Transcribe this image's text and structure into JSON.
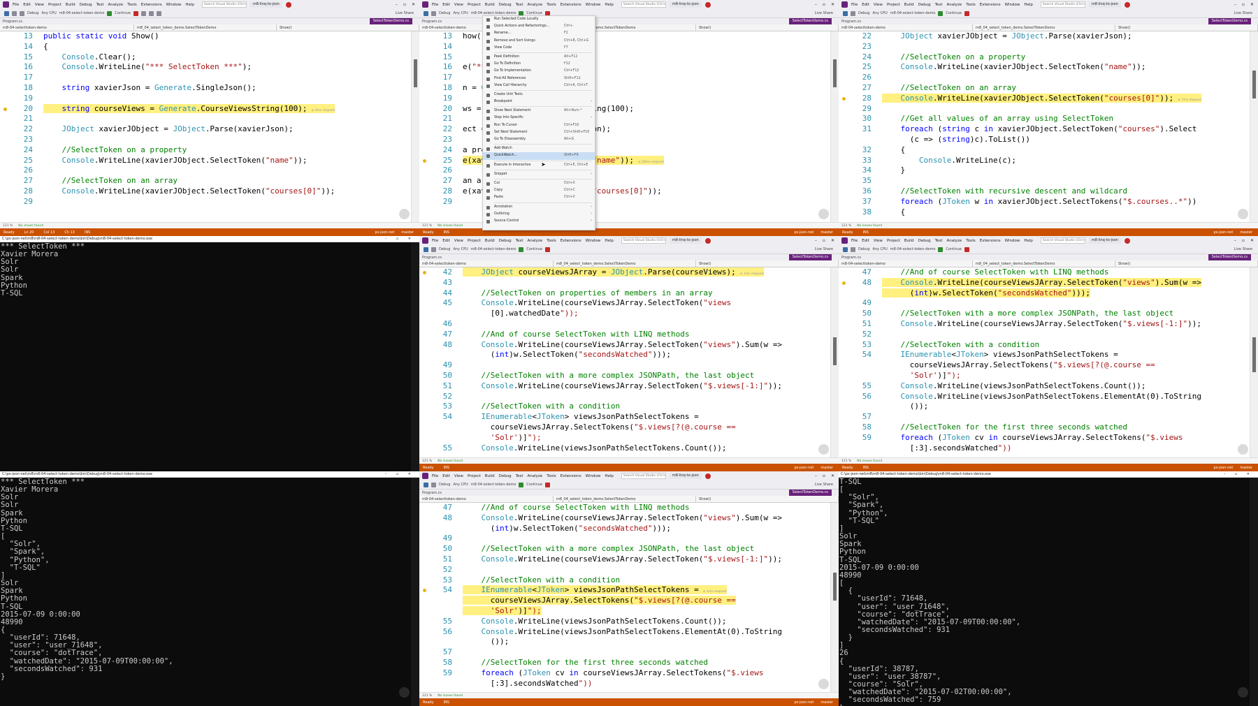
{
  "vs": {
    "menu": [
      "File",
      "Edit",
      "View",
      "Project",
      "Build",
      "Debug",
      "Test",
      "Analyze",
      "Tools",
      "Extensions",
      "Window",
      "Help"
    ],
    "search_placeholder": "Search Visual Studio (Ctrl+Q)",
    "solution": "m8-linq-to-json",
    "live_share": "Live Share",
    "continue": "Continue",
    "debug_config": "Debug",
    "cpu_config": "Any CPU",
    "project_path": "m8-04-select-token-demo",
    "tab_program": "Program.cs",
    "tab_file": "SelectTokenDemo.cs",
    "nav_project": "m8-04-selecttoken-demo",
    "nav_class": "m8_04_select_token_demo.SelectTokenDemo",
    "nav_method": "Show()",
    "references": "1 reference",
    "status_ready": "Ready",
    "status_noissues": "No issues found",
    "status_zoom": "121 %",
    "status_repo": "ps-json-net",
    "status_branch": "master",
    "status_ins": "INS",
    "status_ln1": "Ln 20",
    "status_col1": "Col 13",
    "status_ch1": "Ch 13",
    "elapsed": "≤ 4ms elapsed",
    "elapsed2": "≤ 28ms elapsed",
    "elapsed3": "≤ 7ms elapsed",
    "elapsed4": "≤ 1ms elapsed"
  },
  "panes": {
    "p1": {
      "lines": [
        {
          "n": "13",
          "h": "public static void Show()"
        },
        {
          "n": "14",
          "h": "{"
        },
        {
          "n": "15",
          "h": "    Console.Clear();"
        },
        {
          "n": "16",
          "h": "    Console.WriteLine(\"*** SelectToken ***\");"
        },
        {
          "n": "17",
          "h": ""
        },
        {
          "n": "18",
          "h": "    string xavierJson = Generate.SingleJson();"
        },
        {
          "n": "19",
          "h": ""
        },
        {
          "n": "20",
          "h": "    string courseViews = Generate.CourseViewsString(100);"
        },
        {
          "n": "21",
          "h": ""
        },
        {
          "n": "22",
          "h": "    JObject xavierJObject = JObject.Parse(xavierJson);"
        },
        {
          "n": "23",
          "h": ""
        },
        {
          "n": "24",
          "h": "    //SelectToken on a property"
        },
        {
          "n": "25",
          "h": "    Console.WriteLine(xavierJObject.SelectToken(\"name\"));"
        },
        {
          "n": "26",
          "h": ""
        },
        {
          "n": "27",
          "h": "    //SelectToken on an array"
        },
        {
          "n": "28",
          "h": "    Console.WriteLine(xavierJObject.SelectToken(\"courses[0]\"));"
        },
        {
          "n": "29",
          "h": ""
        }
      ]
    },
    "p2": {
      "lines": [
        {
          "n": "13",
          "h": "how()"
        },
        {
          "n": "14",
          "h": ""
        },
        {
          "n": "15",
          "h": ""
        },
        {
          "n": "16",
          "h": "e(\"*** SelectToken ***\");"
        },
        {
          "n": "17",
          "h": ""
        },
        {
          "n": "18",
          "h": "n = Generate.SingleJson();"
        },
        {
          "n": "19",
          "h": ""
        },
        {
          "n": "20",
          "h": "ws = Generate.CourseViewsString(100);"
        },
        {
          "n": "21",
          "h": ""
        },
        {
          "n": "22",
          "h": "ect = JObject.Parse(xavierJson);"
        },
        {
          "n": "23",
          "h": ""
        },
        {
          "n": "24",
          "h": "a property"
        },
        {
          "n": "25",
          "h": "e(xavierJObject.SelectToken(\"name\"));"
        },
        {
          "n": "26",
          "h": ""
        },
        {
          "n": "27",
          "h": "an array"
        },
        {
          "n": "28",
          "h": "e(xavierJObject.SelectToken(\"courses[0]\"));"
        },
        {
          "n": "29",
          "h": ""
        }
      ]
    },
    "p3": {
      "lines": [
        {
          "n": "22",
          "h": "    JObject xavierJObject = JObject.Parse(xavierJson);"
        },
        {
          "n": "23",
          "h": ""
        },
        {
          "n": "24",
          "h": "    //SelectToken on a property"
        },
        {
          "n": "25",
          "h": "    Console.WriteLine(xavierJObject.SelectToken(\"name\"));"
        },
        {
          "n": "26",
          "h": ""
        },
        {
          "n": "27",
          "h": "    //SelectToken on an array"
        },
        {
          "n": "28",
          "h": "    Console.WriteLine(xavierJObject.SelectToken(\"courses[0]\"));"
        },
        {
          "n": "29",
          "h": ""
        },
        {
          "n": "30",
          "h": "    //Get all values of an array using SelectToken"
        },
        {
          "n": "31",
          "h": "    foreach (string c in xavierJObject.SelectToken(\"courses\").Select"
        },
        {
          "n": "",
          "h": "      (c => (string)c).ToList())"
        },
        {
          "n": "32",
          "h": "    {"
        },
        {
          "n": "33",
          "h": "        Console.WriteLine(c);"
        },
        {
          "n": "34",
          "h": "    }"
        },
        {
          "n": "35",
          "h": ""
        },
        {
          "n": "36",
          "h": "    //SelectToken with recursive descent and wildcard"
        },
        {
          "n": "37",
          "h": "    foreach (JToken w in xavierJObject.SelectTokens(\"$.courses..*\"))"
        },
        {
          "n": "38",
          "h": "    {"
        }
      ]
    },
    "p5": {
      "lines": [
        {
          "n": "42",
          "h": "    JObject courseViewsJArray = JObject.Parse(courseViews);"
        },
        {
          "n": "43",
          "h": ""
        },
        {
          "n": "44",
          "h": "    //SelectToken on properties of members in an array"
        },
        {
          "n": "45",
          "h": "    Console.WriteLine(courseViewsJArray.SelectToken(\"views"
        },
        {
          "n": "",
          "h": "      [0].watchedDate\"));"
        },
        {
          "n": "46",
          "h": ""
        },
        {
          "n": "47",
          "h": "    //And of course SelectToken with LINQ methods"
        },
        {
          "n": "48",
          "h": "    Console.WriteLine(courseViewsJArray.SelectToken(\"views\").Sum(w =>"
        },
        {
          "n": "",
          "h": "      (int)w.SelectToken(\"secondsWatched\")));"
        },
        {
          "n": "49",
          "h": ""
        },
        {
          "n": "50",
          "h": "    //SelectToken with a more complex JSONPath, the last object"
        },
        {
          "n": "51",
          "h": "    Console.WriteLine(courseViewsJArray.SelectToken(\"$.views[-1:]\"));"
        },
        {
          "n": "52",
          "h": ""
        },
        {
          "n": "53",
          "h": "    //SelectToken with a condition"
        },
        {
          "n": "54",
          "h": "    IEnumerable<JToken> viewsJsonPathSelectTokens ="
        },
        {
          "n": "",
          "h": "      courseViewsJArray.SelectTokens(\"$.views[?(@.course =="
        },
        {
          "n": "",
          "h": "      'Solr')]\");"
        },
        {
          "n": "55",
          "h": "    Console.WriteLine(viewsJsonPathSelectTokens.Count());"
        }
      ]
    },
    "p6": {
      "lines": [
        {
          "n": "47",
          "h": "    //And of course SelectToken with LINQ methods"
        },
        {
          "n": "48",
          "h": "    Console.WriteLine(courseViewsJArray.SelectToken(\"views\").Sum(w =>"
        },
        {
          "n": "",
          "h": "      (int)w.SelectToken(\"secondsWatched\")));"
        },
        {
          "n": "49",
          "h": ""
        },
        {
          "n": "50",
          "h": "    //SelectToken with a more complex JSONPath, the last object"
        },
        {
          "n": "51",
          "h": "    Console.WriteLine(courseViewsJArray.SelectToken(\"$.views[-1:]\"));"
        },
        {
          "n": "52",
          "h": ""
        },
        {
          "n": "53",
          "h": "    //SelectToken with a condition"
        },
        {
          "n": "54",
          "h": "    IEnumerable<JToken> viewsJsonPathSelectTokens ="
        },
        {
          "n": "",
          "h": "      courseViewsJArray.SelectTokens(\"$.views[?(@.course =="
        },
        {
          "n": "",
          "h": "      'Solr')]\");"
        },
        {
          "n": "55",
          "h": "    Console.WriteLine(viewsJsonPathSelectTokens.Count());"
        },
        {
          "n": "56",
          "h": "    Console.WriteLine(viewsJsonPathSelectTokens.ElementAt(0).ToString"
        },
        {
          "n": "",
          "h": "      ());"
        },
        {
          "n": "57",
          "h": ""
        },
        {
          "n": "58",
          "h": "    //SelectToken for the first three seconds watched"
        },
        {
          "n": "59",
          "h": "    foreach (JToken cv in courseViewsJArray.SelectTokens(\"$.views"
        },
        {
          "n": "",
          "h": "      [:3].secondsWatched\"))"
        }
      ]
    },
    "p8": {
      "lines": [
        {
          "n": "47",
          "h": "    //And of course SelectToken with LINQ methods"
        },
        {
          "n": "48",
          "h": "    Console.WriteLine(courseViewsJArray.SelectToken(\"views\").Sum(w =>"
        },
        {
          "n": "",
          "h": "      (int)w.SelectToken(\"secondsWatched\")));"
        },
        {
          "n": "49",
          "h": ""
        },
        {
          "n": "50",
          "h": "    //SelectToken with a more complex JSONPath, the last object"
        },
        {
          "n": "51",
          "h": "    Console.WriteLine(courseViewsJArray.SelectToken(\"$.views[-1:]\"));"
        },
        {
          "n": "52",
          "h": ""
        },
        {
          "n": "53",
          "h": "    //SelectToken with a condition"
        },
        {
          "n": "54",
          "h": "    IEnumerable<JToken> viewsJsonPathSelectTokens ="
        },
        {
          "n": "",
          "h": "      courseViewsJArray.SelectTokens(\"$.views[?(@.course =="
        },
        {
          "n": "",
          "h": "      'Solr')]\");"
        },
        {
          "n": "55",
          "h": "    Console.WriteLine(viewsJsonPathSelectTokens.Count());"
        },
        {
          "n": "56",
          "h": "    Console.WriteLine(viewsJsonPathSelectTokens.ElementAt(0).ToString"
        },
        {
          "n": "",
          "h": "      ());"
        },
        {
          "n": "57",
          "h": ""
        },
        {
          "n": "58",
          "h": "    //SelectToken for the first three seconds watched"
        },
        {
          "n": "59",
          "h": "    foreach (JToken cv in courseViewsJArray.SelectTokens(\"$.views"
        },
        {
          "n": "",
          "h": "      [:3].secondsWatched\"))"
        }
      ]
    }
  },
  "console": {
    "title": "C:\\ps-json-net\\m8\\m8-04-select-token-demo\\bin\\Debug\\m8-04-select-token-demo.exe",
    "out1": "*** SelectToken ***\nXavier Morera\nSolr\nSolr\nSpark\nPython\nT-SQL",
    "out2": "*** SelectToken ***\nXavier Morera\nSolr\nSolr\nSpark\nPython\nT-SQL\n[\n  \"Solr\",\n  \"Spark\",\n  \"Python\",\n  \"T-SQL\"\n]\nSolr\nSpark\nPython\nT-SQL\n2015-07-09 0:00:00\n48990\n{\n  \"userId\": 71648,\n  \"user\": \"user_71648\",\n  \"course\": \"dotTrace\",\n  \"watchedDate\": \"2015-07-09T00:00:00\",\n  \"secondsWatched\": 931\n}",
    "out3": "T-SQL\n[\n  \"Solr\",\n  \"Spark\",\n  \"Python\",\n  \"T-SQL\"\n]\nSolr\nSpark\nPython\nT-SQL\n2015-07-09 0:00:00\n48990\n[\n  {\n    \"userId\": 71648,\n    \"user\": \"user_71648\",\n    \"course\": \"dotTrace\",\n    \"watchedDate\": \"2015-07-09T00:00:00\",\n    \"secondsWatched\": 931\n  }\n]\n26\n{\n  \"userId\": 38787,\n  \"user\": \"user_38787\",\n  \"course\": \"Solr\",\n  \"watchedDate\": \"2015-07-02T00:00:00\",\n  \"secondsWatched\": 759\n}"
  },
  "context_menu": [
    {
      "label": "Run Selected Code Locally",
      "sc": ""
    },
    {
      "label": "Quick Actions and Refactorings...",
      "sc": "Ctrl+."
    },
    {
      "label": "Rename...",
      "sc": "F2"
    },
    {
      "label": "Remove and Sort Usings",
      "sc": "Ctrl+R, Ctrl+G"
    },
    {
      "label": "View Code",
      "sc": "F7"
    },
    {
      "sep": true
    },
    {
      "label": "Peek Definition",
      "sc": "Alt+F12"
    },
    {
      "label": "Go To Definition",
      "sc": "F12"
    },
    {
      "label": "Go To Implementation",
      "sc": "Ctrl+F12"
    },
    {
      "label": "Find All References",
      "sc": "Shift+F12"
    },
    {
      "label": "View Call Hierarchy",
      "sc": "Ctrl+K, Ctrl+T"
    },
    {
      "sep": true
    },
    {
      "label": "Create Unit Tests",
      "sc": ""
    },
    {
      "label": "Breakpoint",
      "sc": "",
      "arr": true
    },
    {
      "sep": true
    },
    {
      "label": "Show Next Statement",
      "sc": "Alt+Num *"
    },
    {
      "label": "Step Into Specific",
      "sc": "",
      "arr": true
    },
    {
      "label": "Run To Cursor",
      "sc": "Ctrl+F10"
    },
    {
      "label": "Set Next Statement",
      "sc": "Ctrl+Shift+F10"
    },
    {
      "label": "Go To Disassembly",
      "sc": "Alt+G"
    },
    {
      "sep": true
    },
    {
      "label": "Add Watch",
      "sc": ""
    },
    {
      "label": "QuickWatch...",
      "sc": "Shift+F9",
      "active": true
    },
    {
      "sep": true
    },
    {
      "label": "Execute in Interactive",
      "sc": "Ctrl+E, Ctrl+E"
    },
    {
      "sep": true
    },
    {
      "label": "Snippet",
      "sc": "",
      "arr": true
    },
    {
      "sep": true
    },
    {
      "label": "Cut",
      "sc": "Ctrl+X"
    },
    {
      "label": "Copy",
      "sc": "Ctrl+C"
    },
    {
      "label": "Paste",
      "sc": "Ctrl+V"
    },
    {
      "sep": true
    },
    {
      "label": "Annotation",
      "sc": "",
      "arr": true
    },
    {
      "label": "Outlining",
      "sc": "",
      "arr": true
    },
    {
      "label": "Source Control",
      "sc": "",
      "arr": true
    }
  ]
}
